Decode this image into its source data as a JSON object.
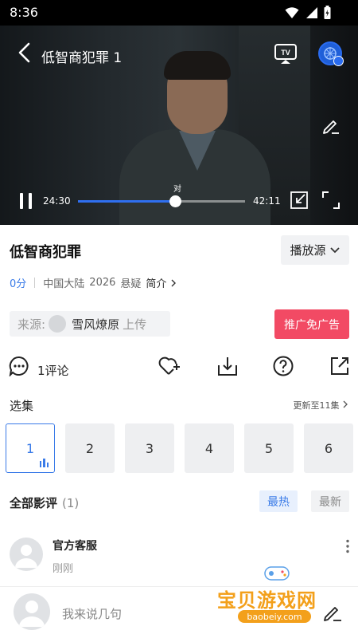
{
  "status_bar": {
    "time": "8:36"
  },
  "player": {
    "title": "低智商犯罪 1",
    "subtitle_caption": "对",
    "current_time": "24:30",
    "total_time": "42:11",
    "progress": 0.58,
    "tv_label": "TV"
  },
  "show": {
    "title": "低智商犯罪",
    "source_button": "播放源",
    "score": "0分",
    "region": "中国大陆",
    "year": "2026",
    "genre": "悬疑",
    "intro_link": "简介"
  },
  "uploader": {
    "label": "来源:",
    "name": "雪风燎原",
    "suffix": "上传"
  },
  "promo_button": "推广免广告",
  "actions": {
    "comment_count": "1评论"
  },
  "episodes": {
    "heading": "选集",
    "update_text": "更新至11集",
    "items": [
      "1",
      "2",
      "3",
      "4",
      "5",
      "6"
    ],
    "active_index": 0
  },
  "reviews": {
    "heading": "全部影评",
    "count": "(1)",
    "tab_hot": "最热",
    "tab_new": "最新",
    "items": [
      {
        "name": "官方客服",
        "time": "刚刚"
      }
    ]
  },
  "composer": {
    "placeholder": "我来说几句"
  },
  "watermark": {
    "text": "宝贝游戏网",
    "url": "baobeiy.com"
  },
  "colors": {
    "accent": "#3a7be8",
    "promo": "#f24a64",
    "watermark": "#f3a01b"
  }
}
